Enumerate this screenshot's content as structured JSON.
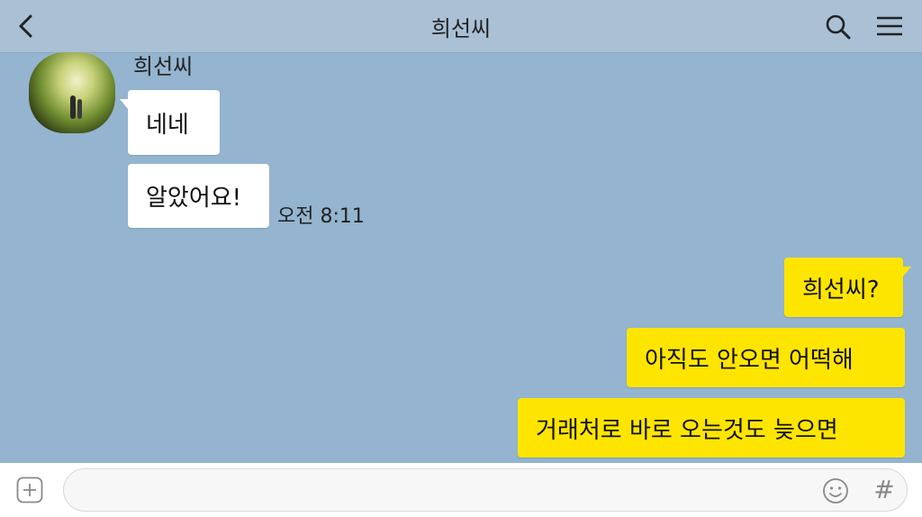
{
  "header": {
    "title": "희선씨",
    "back_icon": "chevron-left-icon",
    "search_icon": "search-icon",
    "menu_icon": "menu-icon"
  },
  "conversation": {
    "sender_name": "희선씨",
    "incoming": [
      {
        "text": "네네"
      },
      {
        "text": "알았어요!"
      }
    ],
    "incoming_time": "오전 8:11",
    "outgoing": [
      {
        "text": "희선씨?"
      },
      {
        "text": "아직도 안오면 어떡해"
      },
      {
        "text": "거래처로 바로 오는것도 늦으면"
      }
    ]
  },
  "composer": {
    "plus_icon": "plus-icon",
    "emoji_icon": "emoji-icon",
    "hash_label": "#"
  },
  "colors": {
    "chat_background": "#94b4cf",
    "outgoing_bubble": "#fee500",
    "incoming_bubble": "#ffffff"
  }
}
